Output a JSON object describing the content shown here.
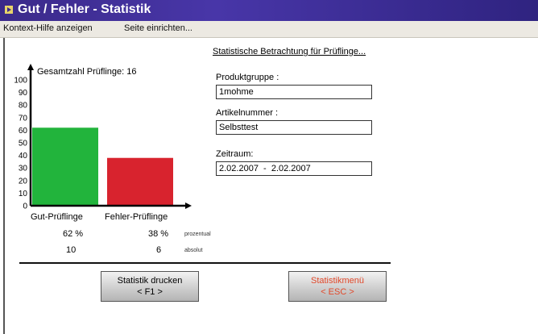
{
  "window": {
    "title": "Gut / Fehler - Statistik"
  },
  "menu": {
    "items": [
      "Kontext-Hilfe anzeigen",
      "Seite einrichten..."
    ]
  },
  "stats": {
    "total_label": "Gesamtzahl Prüflinge: 16",
    "row_labels": {
      "percent": "prozentual",
      "absolute": "absolut"
    },
    "categories": [
      {
        "label": "Gut-Prüflinge",
        "percent": "62 %",
        "absolute": "10",
        "color": "#22b43c"
      },
      {
        "label": "Fehler-Prüflinge",
        "percent": "38 %",
        "absolute": "6",
        "color": "#d8232e"
      }
    ]
  },
  "chart_data": {
    "type": "bar",
    "categories": [
      "Gut-Prüflinge",
      "Fehler-Prüflinge"
    ],
    "values": [
      62,
      38
    ],
    "ylim": [
      0,
      100
    ],
    "yticks": [
      0,
      10,
      20,
      30,
      40,
      50,
      60,
      70,
      80,
      90,
      100
    ],
    "ytick_labels": [
      "0",
      "10",
      "20",
      "30",
      "40",
      "50",
      "60",
      "70",
      "80",
      "90",
      "100"
    ],
    "colors": [
      "#22b43c",
      "#d8232e"
    ],
    "grid": false
  },
  "details": {
    "section_title": "Statistische Betrachtung für Prüflinge...",
    "product_group": {
      "label": "Produktgruppe :",
      "value": "1mohme"
    },
    "article_number": {
      "label": "Artikelnummer :",
      "value": "Selbsttest"
    },
    "period": {
      "label": "Zeitraum:",
      "value": "2.02.2007  -  2.02.2007"
    }
  },
  "buttons": {
    "print": {
      "line1": "Statistik drucken",
      "line2": "< F1 >"
    },
    "menu": {
      "line1": "Statistikmenü",
      "line2": "< ESC >",
      "color": "#e0482a"
    }
  }
}
